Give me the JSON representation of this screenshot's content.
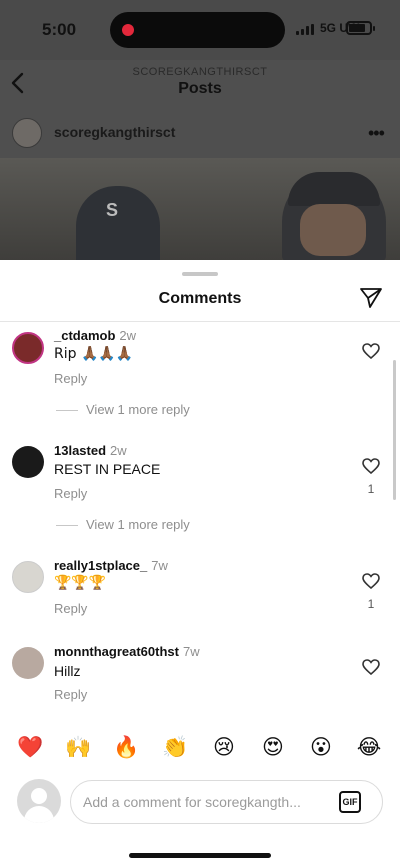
{
  "status_bar": {
    "time": "5:00",
    "network": "5G UW",
    "battery_level": 0.8
  },
  "post_header": {
    "account_name": "SCOREGKANGTHIRSCT",
    "title": "Posts",
    "username": "scoregkangthirsct"
  },
  "sheet": {
    "title": "Comments"
  },
  "comments": [
    {
      "username": "_ctdamob",
      "time": "2w",
      "text": "Rip 🙏🏾🙏🏾🙏🏾",
      "reply_label": "Reply",
      "view_more": "View 1 more reply",
      "likes": "",
      "avatar_color": "#7a2a2a"
    },
    {
      "username": "13lasted",
      "time": "2w",
      "text": "REST IN PEACE",
      "reply_label": "Reply",
      "view_more": "View 1 more reply",
      "likes": "1",
      "avatar_color": "#1a1a1a"
    },
    {
      "username": "really1stplace_",
      "time": "7w",
      "text": "🏆🏆🏆",
      "reply_label": "Reply",
      "view_more": "",
      "likes": "1",
      "avatar_color": "#d8d6d0"
    },
    {
      "username": "monnthagreat60thst",
      "time": "7w",
      "text": "Hillz",
      "reply_label": "Reply",
      "view_more": "",
      "likes": "",
      "avatar_color": "#b8a9a0"
    }
  ],
  "emoji_bar": [
    "❤️",
    "🙌",
    "🔥",
    "👏",
    "😢",
    "😍",
    "😮",
    "😂"
  ],
  "input": {
    "placeholder": "Add a comment for scoregkangth...",
    "gif_label": "GIF"
  }
}
